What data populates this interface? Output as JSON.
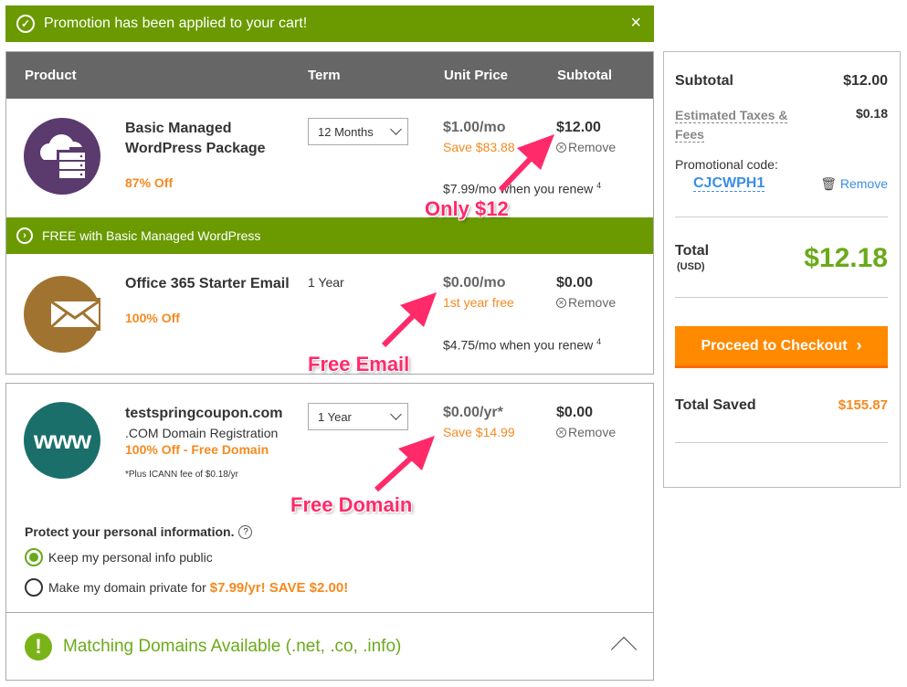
{
  "banner": {
    "message": "Promotion has been applied to your cart!",
    "close_icon": "×",
    "color": "#6a9a00"
  },
  "table": {
    "headers": [
      "Product",
      "Term",
      "Unit Price",
      "Subtotal"
    ]
  },
  "items": [
    {
      "icon": "cloud-server-icon",
      "icon_color": "#5b3a6e",
      "name": "Basic Managed WordPress Package",
      "discount": "87% Off",
      "term": "12 Months",
      "unit_price": "$1.00/mo",
      "unit_note": "Save $83.88",
      "subtotal": "$12.00",
      "remove_label": "Remove",
      "renew_text": "$7.99/mo when you renew",
      "renew_footnote": "4"
    },
    {
      "icon": "envelope-icon",
      "icon_color": "#a07430",
      "name": "Office 365 Starter Email",
      "discount": "100% Off",
      "term": "1 Year",
      "unit_price": "$0.00/mo",
      "unit_note": "1st year free",
      "subtotal": "$0.00",
      "remove_label": "Remove",
      "renew_text": "$4.75/mo when you renew",
      "renew_footnote": "4"
    },
    {
      "icon": "www-icon",
      "icon_color": "#1b6f6a",
      "icon_text": "www",
      "name": "testspringcoupon.com",
      "subtitle": ".COM Domain Registration",
      "discount": "100% Off - Free Domain",
      "note": "*Plus ICANN fee of $0.18/yr",
      "term": "1 Year",
      "unit_price": "$0.00/yr*",
      "unit_note": "Save $14.99",
      "subtotal": "$0.00",
      "remove_label": "Remove"
    }
  ],
  "free_bar": {
    "text": "FREE with Basic Managed WordPress"
  },
  "privacy": {
    "title": "Protect your personal information.",
    "help_icon": "?",
    "options": [
      {
        "label": "Keep my personal info public",
        "selected": true
      },
      {
        "label": "Make my domain private for",
        "price": "$7.99/yr! SAVE $2.00!",
        "selected": false
      }
    ]
  },
  "matching": {
    "icon": "!",
    "text": "Matching Domains Available (.net, .co, .info)"
  },
  "summary": {
    "subtotal_label": "Subtotal",
    "subtotal_value": "$12.00",
    "taxes_label_line1": "Estimated Taxes &",
    "taxes_label_line2": "Fees",
    "taxes_value": "$0.18",
    "promo_label": "Promotional code:",
    "promo_code": "CJCWPH1",
    "promo_remove": "Remove",
    "total_label": "Total",
    "total_currency": "(USD)",
    "total_value": "$12.18",
    "checkout_label": "Proceed to Checkout",
    "saved_label": "Total Saved",
    "saved_value": "$155.87"
  },
  "annotations": {
    "first": "Only $12",
    "second": "Free Email",
    "third": "Free Domain",
    "color": "#ff2a6a"
  }
}
